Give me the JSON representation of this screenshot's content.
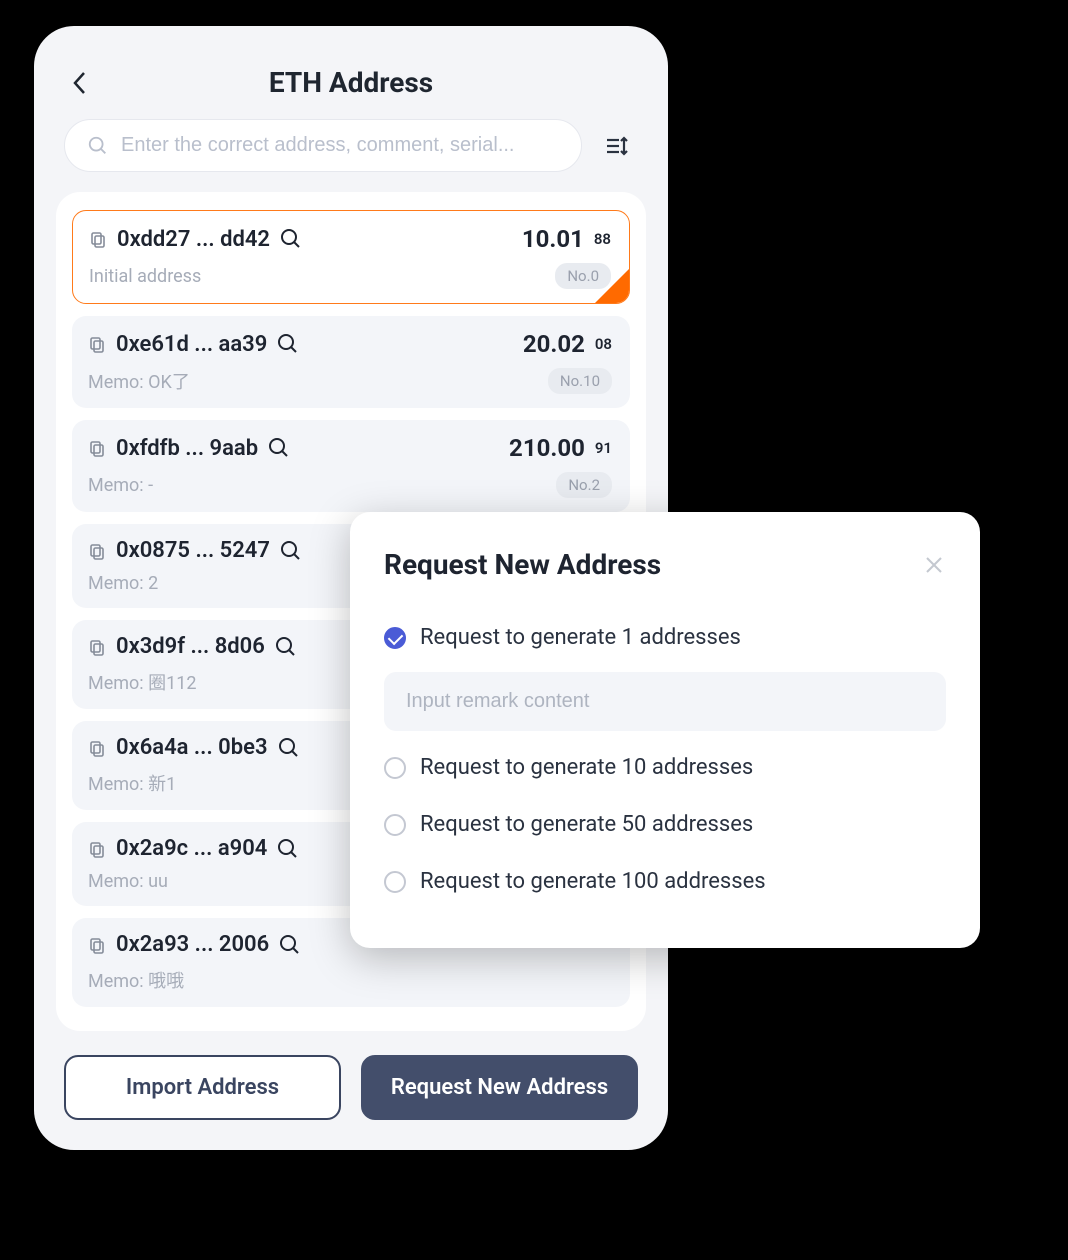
{
  "header": {
    "title": "ETH Address"
  },
  "search": {
    "placeholder": "Enter the correct address, comment, serial..."
  },
  "addresses": [
    {
      "short": "0xdd27 ... dd42",
      "balance": "10.01",
      "balance_suffix": "88",
      "memo": "Initial address",
      "badge": "No.0",
      "selected": true
    },
    {
      "short": "0xe61d ... aa39",
      "balance": "20.02",
      "balance_suffix": "08",
      "memo": "Memo: OK了",
      "badge": "No.10",
      "selected": false
    },
    {
      "short": "0xfdfb ... 9aab",
      "balance": "210.00",
      "balance_suffix": "91",
      "memo": "Memo: -",
      "badge": "No.2",
      "selected": false
    },
    {
      "short": "0x0875 ... 5247",
      "balance": "",
      "balance_suffix": "",
      "memo": "Memo: 2",
      "badge": "",
      "selected": false
    },
    {
      "short": "0x3d9f ... 8d06",
      "balance": "",
      "balance_suffix": "",
      "memo": "Memo: 圈112",
      "badge": "",
      "selected": false
    },
    {
      "short": "0x6a4a ... 0be3",
      "balance": "",
      "balance_suffix": "",
      "memo": "Memo: 新1",
      "badge": "",
      "selected": false
    },
    {
      "short": "0x2a9c ... a904",
      "balance": "",
      "balance_suffix": "",
      "memo": "Memo: uu",
      "badge": "",
      "selected": false
    },
    {
      "short": "0x2a93 ... 2006",
      "balance": "",
      "balance_suffix": "",
      "memo": "Memo: 哦哦",
      "badge": "",
      "selected": false
    }
  ],
  "footer": {
    "import_label": "Import Address",
    "request_label": "Request New Address"
  },
  "modal": {
    "title": "Request New Address",
    "remark_placeholder": "Input remark content",
    "options": [
      {
        "label": "Request to generate 1 addresses",
        "checked": true
      },
      {
        "label": "Request to generate 10 addresses",
        "checked": false
      },
      {
        "label": "Request to generate 50 addresses",
        "checked": false
      },
      {
        "label": "Request to generate 100 addresses",
        "checked": false
      }
    ]
  }
}
